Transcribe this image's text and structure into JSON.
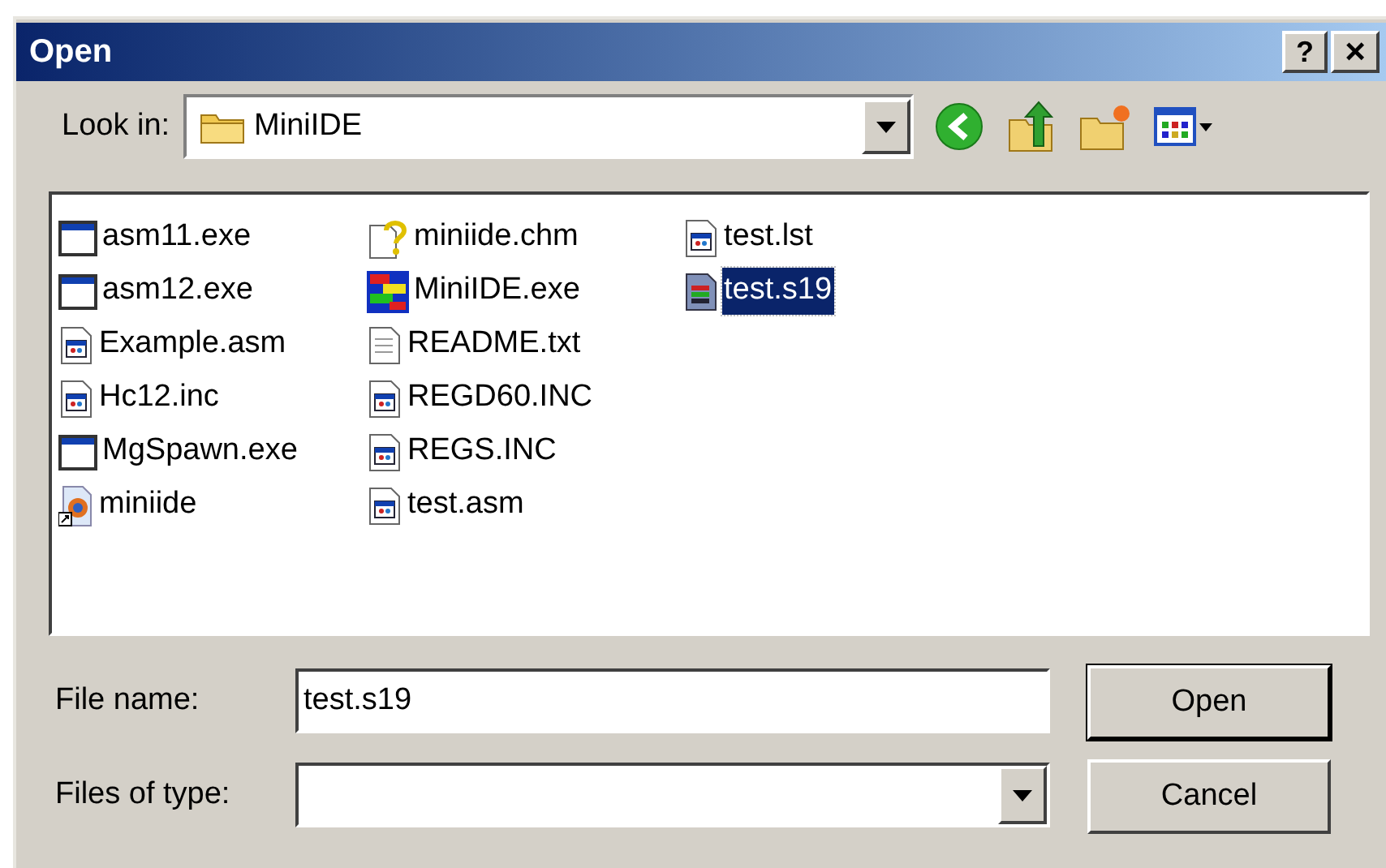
{
  "window": {
    "title": "Open",
    "help_button": "?",
    "close_button": "×"
  },
  "look_in": {
    "label": "Look in:",
    "value": "MiniIDE"
  },
  "files": [
    {
      "name": "asm11.exe",
      "kind": "exe",
      "selected": false
    },
    {
      "name": "asm12.exe",
      "kind": "exe",
      "selected": false
    },
    {
      "name": "Example.asm",
      "kind": "source",
      "selected": false
    },
    {
      "name": "Hc12.inc",
      "kind": "source",
      "selected": false
    },
    {
      "name": "MgSpawn.exe",
      "kind": "exe",
      "selected": false
    },
    {
      "name": "miniide",
      "kind": "shortcut",
      "selected": false
    },
    {
      "name": "miniide.chm",
      "kind": "help",
      "selected": false
    },
    {
      "name": "MiniIDE.exe",
      "kind": "app",
      "selected": false
    },
    {
      "name": "README.txt",
      "kind": "text",
      "selected": false
    },
    {
      "name": "REGD60.INC",
      "kind": "source",
      "selected": false
    },
    {
      "name": "REGS.INC",
      "kind": "source",
      "selected": false
    },
    {
      "name": "test.asm",
      "kind": "source",
      "selected": false
    },
    {
      "name": "test.lst",
      "kind": "source",
      "selected": false
    },
    {
      "name": "test.s19",
      "kind": "record",
      "selected": true
    }
  ],
  "file_name": {
    "label": "File name:",
    "value": "test.s19"
  },
  "files_of_type": {
    "label": "Files of type:"
  },
  "buttons": [
    "Open",
    "Cancel"
  ]
}
